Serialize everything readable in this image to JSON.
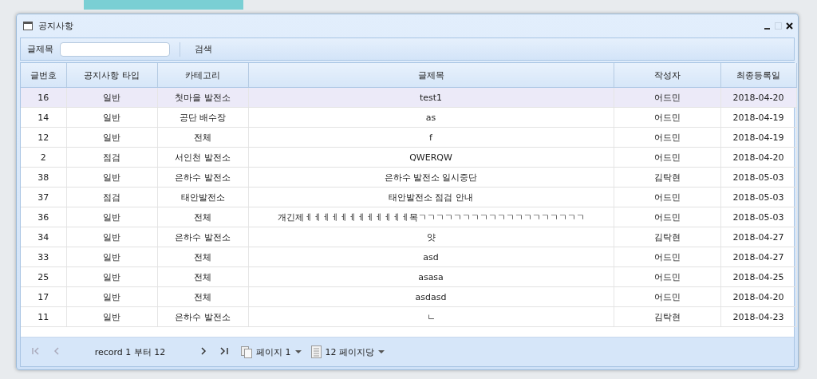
{
  "window": {
    "title": "공지사항"
  },
  "toolbar": {
    "label": "글제목",
    "search_button": "검색"
  },
  "table": {
    "columns": [
      "글번호",
      "공지사항 타입",
      "카테고리",
      "글제목",
      "작성자",
      "최종등록일"
    ],
    "rows": [
      {
        "cells": [
          "16",
          "일반",
          "첫마을 발전소",
          "test1",
          "어드민",
          "2018-04-20"
        ],
        "selected": true
      },
      {
        "cells": [
          "14",
          "일반",
          "공단 배수장",
          "as",
          "어드민",
          "2018-04-19"
        ],
        "selected": false
      },
      {
        "cells": [
          "12",
          "일반",
          "전체",
          "f",
          "어드민",
          "2018-04-19"
        ],
        "selected": false
      },
      {
        "cells": [
          "2",
          "점검",
          "서인천 발전소",
          "QWERQW",
          "어드민",
          "2018-04-20"
        ],
        "selected": false
      },
      {
        "cells": [
          "38",
          "일반",
          "은하수 발전소",
          "은하수 발전소 일시중단",
          "김탁현",
          "2018-05-03"
        ],
        "selected": false
      },
      {
        "cells": [
          "37",
          "점검",
          "태안발전소",
          "태안발전소 점검 안내",
          "어드민",
          "2018-05-03"
        ],
        "selected": false
      },
      {
        "cells": [
          "36",
          "일반",
          "전체",
          "개긴제ㅔㅔㅔㅔㅔㅔㅔㅔㅔㅔㅔㅔ목ㄱㄱㄱㄱㄱㄱㄱㄱㄱㄱㄱㄱㄱㄱㄱㄱㄱㄱㄱ",
          "어드민",
          "2018-05-03"
        ],
        "selected": false
      },
      {
        "cells": [
          "34",
          "일반",
          "은하수 발전소",
          "얏",
          "김탁현",
          "2018-04-27"
        ],
        "selected": false
      },
      {
        "cells": [
          "33",
          "일반",
          "전체",
          "asd",
          "어드민",
          "2018-04-27"
        ],
        "selected": false
      },
      {
        "cells": [
          "25",
          "일반",
          "전체",
          "asasa",
          "어드민",
          "2018-04-25"
        ],
        "selected": false
      },
      {
        "cells": [
          "17",
          "일반",
          "전체",
          "asdasd",
          "어드민",
          "2018-04-20"
        ],
        "selected": false
      },
      {
        "cells": [
          "11",
          "일반",
          "은하수 발전소",
          "ㄴ",
          "김탁현",
          "2018-04-23"
        ],
        "selected": false
      }
    ]
  },
  "pager": {
    "record_text": "record 1 부터 12",
    "page": "페이지 1",
    "page_size": "12 페이지당",
    "first_disabled": true,
    "prev_disabled": true
  }
}
